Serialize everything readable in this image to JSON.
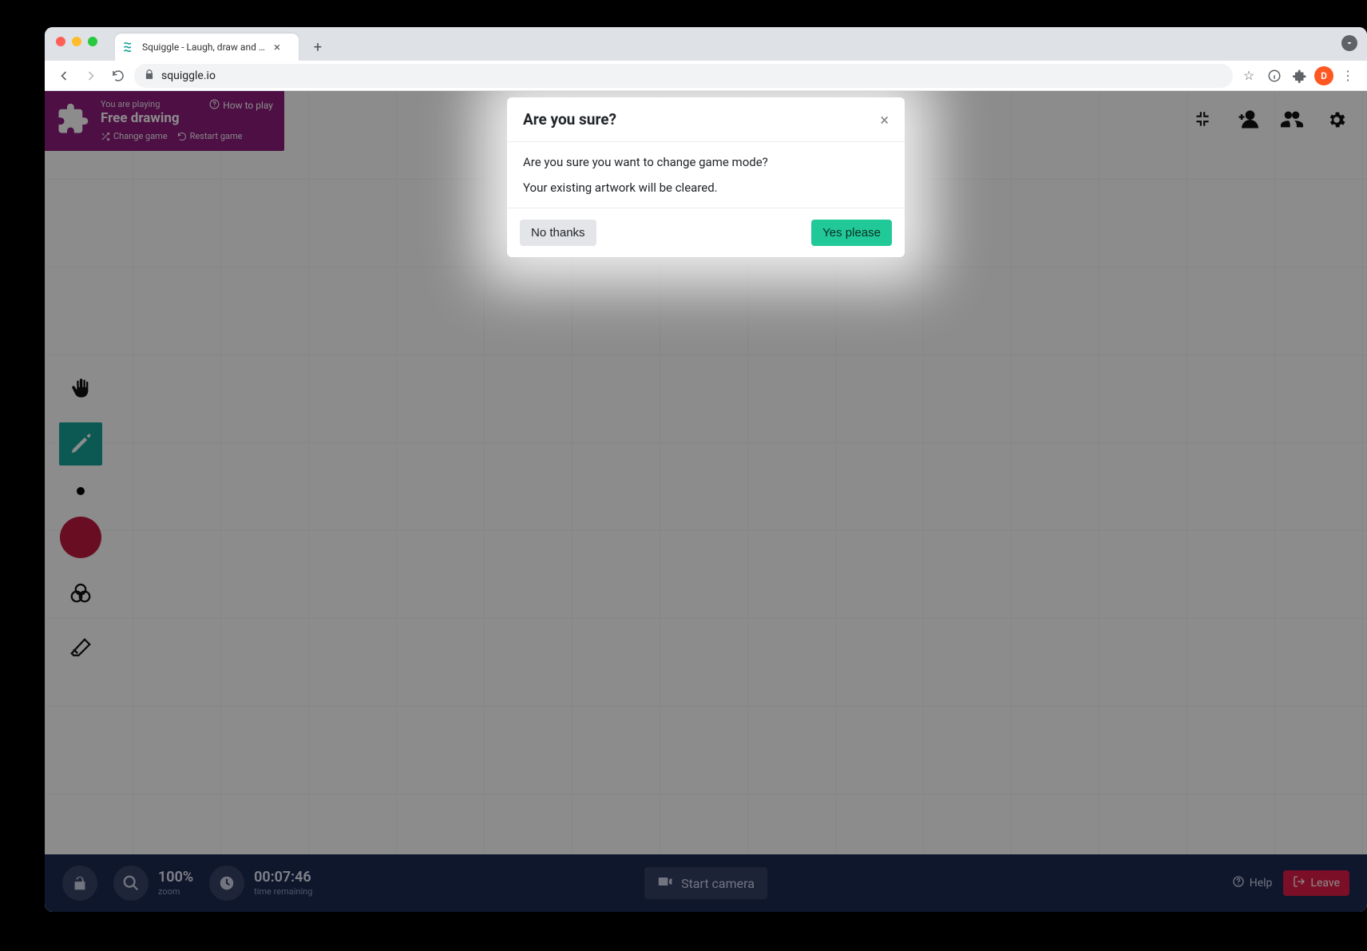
{
  "browser": {
    "tab_title": "Squiggle - Laugh, draw and pla",
    "url": "squiggle.io",
    "avatar_letter": "D"
  },
  "gamecard": {
    "line1": "You are playing",
    "title": "Free drawing",
    "how_to_play": "How to play",
    "change_game": "Change game",
    "restart_game": "Restart game"
  },
  "bottombar": {
    "zoom_value": "100%",
    "zoom_label": "zoom",
    "time_value": "00:07:46",
    "time_label": "time remaining",
    "start_camera": "Start camera",
    "help": "Help",
    "leave": "Leave"
  },
  "modal": {
    "title": "Are you sure?",
    "line1": "Are you sure you want to change game mode?",
    "line2": "Your existing artwork will be cleared.",
    "no": "No thanks",
    "yes": "Yes please"
  },
  "colors": {
    "swatch": "#bf1a3f",
    "tool_active": "#17a397"
  }
}
